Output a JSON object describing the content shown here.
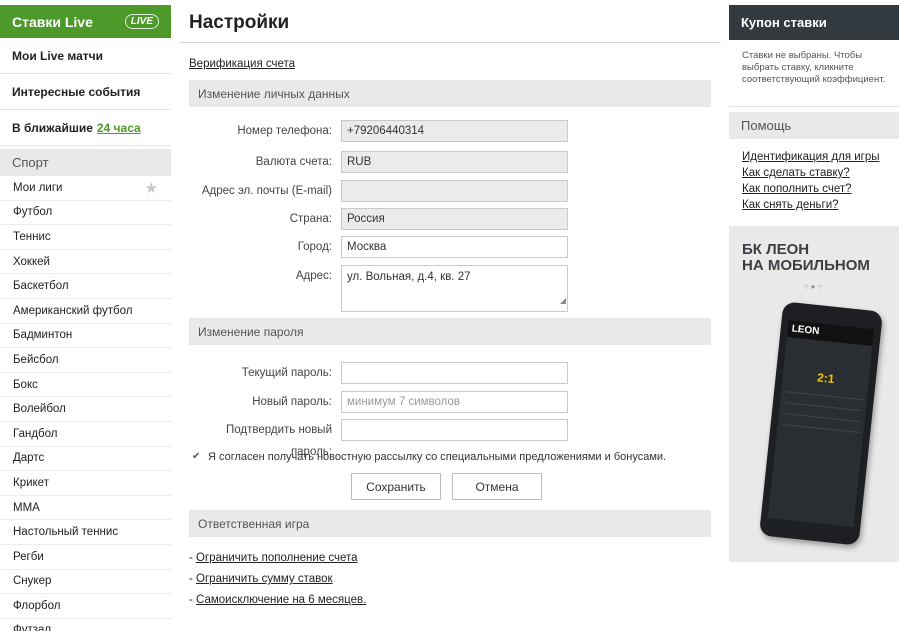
{
  "sidebar": {
    "live_title": "Ставки Live",
    "live_logo": "LIVE",
    "links": [
      {
        "label": "Мои Live матчи"
      },
      {
        "label": "Интересные события"
      }
    ],
    "soon_label": "В ближайшие",
    "soon_value": "24 часа",
    "sport_header": "Спорт",
    "sports": [
      "Мои лиги",
      "Футбол",
      "Теннис",
      "Хоккей",
      "Баскетбол",
      "Американский футбол",
      "Бадминтон",
      "Бейсбол",
      "Бокс",
      "Волейбол",
      "Гандбол",
      "Дартс",
      "Крикет",
      "MMA",
      "Настольный теннис",
      "Регби",
      "Снукер",
      "Флорбол",
      "Футзал"
    ],
    "favorite_icon": "star-icon"
  },
  "main": {
    "title": "Настройки",
    "verification_link": "Верификация счета",
    "personal_section": "Изменение личных данных",
    "fields": {
      "phone_label": "Номер телефона:",
      "phone_value": "+79206440314",
      "currency_label": "Валюта счета:",
      "currency_value": "RUB",
      "email_label": "Адрес эл. почты (E-mail)",
      "email_value": "",
      "country_label": "Страна:",
      "country_value": "Россия",
      "city_label": "Город:",
      "city_value": "Москва",
      "address_label": "Адрес:",
      "address_value": "ул. Вольная, д.4, кв. 27"
    },
    "password_section": "Изменение пароля",
    "password": {
      "current_label": "Текущий пароль:",
      "current_value": "",
      "new_label": "Новый пароль:",
      "new_placeholder": "минимум 7 символов",
      "confirm_label": "Подтвердить новый пароль:",
      "confirm_value": ""
    },
    "newsletter_checked": true,
    "newsletter_text": "Я согласен получать новостную рассылку со специальными предложениями и бонусами.",
    "save_label": "Сохранить",
    "cancel_label": "Отмена",
    "responsible_section": "Ответственная игра",
    "responsible_links": [
      "Ограничить пополнение счета",
      "Ограничить сумму ставок",
      "Самоисключение на 6 месяцев."
    ]
  },
  "right": {
    "coupon_title": "Купон ставки",
    "coupon_text": "Ставки не выбраны. Чтобы выбрать ставку, кликните соответствующий коэффициент.",
    "help_title": "Помощь",
    "help_links": [
      "Идентификация для игры",
      "Как сделать ставку?",
      "Как пополнить счет?",
      "Как снять деньги?"
    ],
    "promo_line1": "БК ЛЕОН",
    "promo_line2": "НА МОБИЛЬНОМ",
    "phone_logo": "LEON",
    "phone_score": "2:1"
  }
}
